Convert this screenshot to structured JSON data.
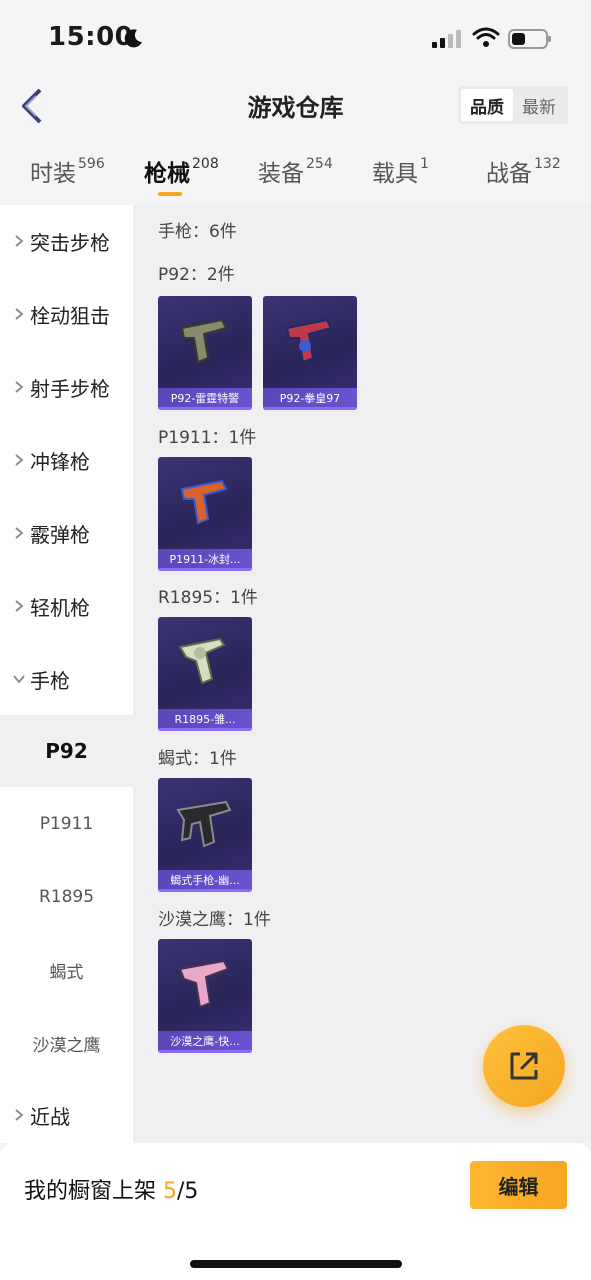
{
  "status_bar": {
    "time": "15:00"
  },
  "header": {
    "title": "游戏仓库",
    "sort_options": [
      "品质",
      "最新"
    ]
  },
  "tabs": [
    {
      "label": "时装",
      "count": "596"
    },
    {
      "label": "枪械",
      "count": "208"
    },
    {
      "label": "装备",
      "count": "254"
    },
    {
      "label": "载具",
      "count": "1"
    },
    {
      "label": "战备",
      "count": "132"
    }
  ],
  "sidebar": {
    "categories": [
      "突击步枪",
      "栓动狙击",
      "射手步枪",
      "冲锋枪",
      "霰弹枪",
      "轻机枪",
      "手枪"
    ],
    "subitems": [
      "P92",
      "P1911",
      "R1895",
      "蝎式",
      "沙漠之鹰"
    ],
    "bottom_category": "近战"
  },
  "content": {
    "summary": "手枪：6件",
    "groups": [
      {
        "label": "P92：2件",
        "items": [
          "P92-雷霆特警",
          "P92-拳皇97"
        ]
      },
      {
        "label": "P1911：1件",
        "items": [
          "P1911-冰封..."
        ]
      },
      {
        "label": "R1895：1件",
        "items": [
          "R1895-雏..."
        ]
      },
      {
        "label": "蝎式：1件",
        "items": [
          "蝎式手枪-幽..."
        ]
      },
      {
        "label": "沙漠之鹰：1件",
        "items": [
          "沙漠之鹰-快..."
        ]
      }
    ]
  },
  "bottom_bar": {
    "showcase_label": "我的橱窗上架",
    "showcase_current": "5",
    "showcase_total": "/5",
    "edit_label": "编辑"
  },
  "colors": {
    "accent": "#f5a623",
    "card_bg": "#2a2558",
    "card_stripe": "#5a47b8"
  }
}
